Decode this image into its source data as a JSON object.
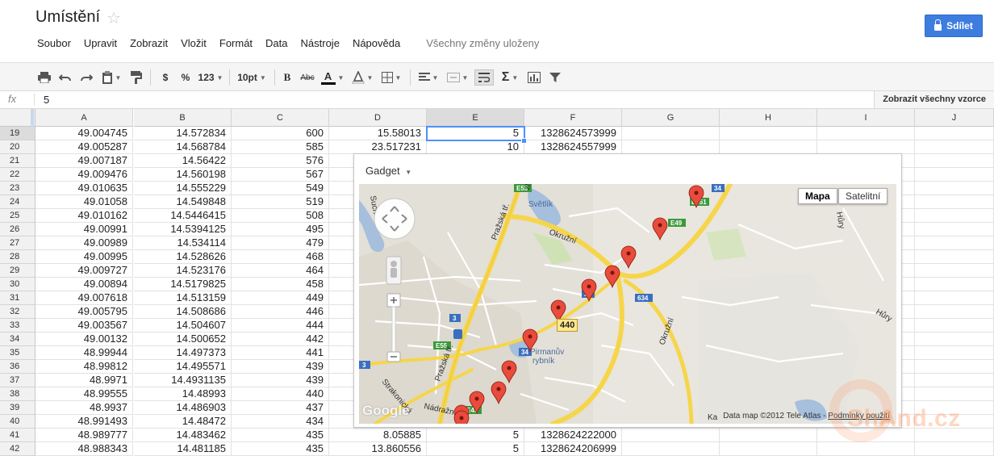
{
  "doc": {
    "title": "Umístění",
    "star_icon": "star-outline-icon"
  },
  "menu": [
    "Soubor",
    "Upravit",
    "Zobrazit",
    "Vložit",
    "Formát",
    "Data",
    "Nástroje",
    "Nápověda"
  ],
  "save_status": "Všechny změny uloženy",
  "share_label": "Sdílet",
  "toolbar": {
    "currency": "$",
    "percent": "%",
    "number_format": "123",
    "font_size": "10pt",
    "bold": "B",
    "strikethrough": "Abc",
    "text_color": "A",
    "text_color_value": "#000000"
  },
  "formula_bar": {
    "fx": "fx",
    "value": "5",
    "show_all": "Zobrazit všechny vzorce"
  },
  "columns": [
    "A",
    "B",
    "C",
    "D",
    "E",
    "F",
    "G",
    "H",
    "I",
    "J"
  ],
  "selected_column": "E",
  "selected_row": "19",
  "rows": [
    {
      "n": "19",
      "a": "49.004745",
      "b": "14.572834",
      "c": "600",
      "d": "15.58013",
      "e": "5",
      "f": "1328624573999"
    },
    {
      "n": "20",
      "a": "49.005287",
      "b": "14.568784",
      "c": "585",
      "d": "23.517231",
      "e": "10",
      "f": "1328624557999"
    },
    {
      "n": "21",
      "a": "49.007187",
      "b": "14.56422",
      "c": "576",
      "d": "",
      "e": "",
      "f": ""
    },
    {
      "n": "22",
      "a": "49.009476",
      "b": "14.560198",
      "c": "567",
      "d": "",
      "e": "",
      "f": ""
    },
    {
      "n": "23",
      "a": "49.010635",
      "b": "14.555229",
      "c": "549",
      "d": "",
      "e": "",
      "f": ""
    },
    {
      "n": "24",
      "a": "49.01058",
      "b": "14.549848",
      "c": "519",
      "d": "",
      "e": "",
      "f": ""
    },
    {
      "n": "25",
      "a": "49.010162",
      "b": "14.5446415",
      "c": "508",
      "d": "",
      "e": "",
      "f": ""
    },
    {
      "n": "26",
      "a": "49.00991",
      "b": "14.5394125",
      "c": "495",
      "d": "",
      "e": "",
      "f": ""
    },
    {
      "n": "27",
      "a": "49.00989",
      "b": "14.534114",
      "c": "479",
      "d": "",
      "e": "",
      "f": ""
    },
    {
      "n": "28",
      "a": "49.00995",
      "b": "14.528626",
      "c": "468",
      "d": "",
      "e": "",
      "f": ""
    },
    {
      "n": "29",
      "a": "49.009727",
      "b": "14.523176",
      "c": "464",
      "d": "",
      "e": "",
      "f": ""
    },
    {
      "n": "30",
      "a": "49.00894",
      "b": "14.5179825",
      "c": "458",
      "d": "",
      "e": "",
      "f": ""
    },
    {
      "n": "31",
      "a": "49.007618",
      "b": "14.513159",
      "c": "449",
      "d": "",
      "e": "",
      "f": ""
    },
    {
      "n": "32",
      "a": "49.005795",
      "b": "14.508686",
      "c": "446",
      "d": "",
      "e": "",
      "f": ""
    },
    {
      "n": "33",
      "a": "49.003567",
      "b": "14.504607",
      "c": "444",
      "d": "",
      "e": "",
      "f": ""
    },
    {
      "n": "34",
      "a": "49.00132",
      "b": "14.500652",
      "c": "442",
      "d": "",
      "e": "",
      "f": ""
    },
    {
      "n": "35",
      "a": "48.99944",
      "b": "14.497373",
      "c": "441",
      "d": "",
      "e": "",
      "f": ""
    },
    {
      "n": "36",
      "a": "48.99812",
      "b": "14.495571",
      "c": "439",
      "d": "",
      "e": "",
      "f": ""
    },
    {
      "n": "37",
      "a": "48.9971",
      "b": "14.4931135",
      "c": "439",
      "d": "",
      "e": "",
      "f": ""
    },
    {
      "n": "38",
      "a": "48.99555",
      "b": "14.48993",
      "c": "440",
      "d": "",
      "e": "",
      "f": ""
    },
    {
      "n": "39",
      "a": "48.9937",
      "b": "14.486903",
      "c": "437",
      "d": "",
      "e": "",
      "f": ""
    },
    {
      "n": "40",
      "a": "48.991493",
      "b": "14.48472",
      "c": "434",
      "d": "",
      "e": "",
      "f": ""
    },
    {
      "n": "41",
      "a": "48.989777",
      "b": "14.483462",
      "c": "435",
      "d": "8.05885",
      "e": "5",
      "f": "1328624222000"
    },
    {
      "n": "42",
      "a": "48.988343",
      "b": "14.481185",
      "c": "435",
      "d": "13.860556",
      "e": "5",
      "f": "1328624206999"
    }
  ],
  "gadget": {
    "title": "Gadget",
    "map_type_map": "Mapa",
    "map_type_satellite": "Satelitní",
    "copyright": "Data map ©2012 Tele Atlas -",
    "terms_link": "Podmínky použití",
    "google_logo": "Google",
    "marker_tooltip": "440",
    "labels": {
      "pivovar": "Pražská tř.",
      "okruzni1": "Okružní",
      "okruzni2": "Okružní",
      "svetlik": "Světlík",
      "rybnik1": "Pirmanův",
      "rybnik2": "rybník",
      "nadrazni": "Nádražní",
      "strakonicka": "Strakonická",
      "prazska2": "Pražská tř.",
      "hury1": "Hůry",
      "hury2": "Hůry",
      "such": "Such",
      "ka": "Ka",
      "zlicky": "zlický",
      "e55a": "E55",
      "e55b": "E55",
      "e49a": "E49",
      "e49b": "E49",
      "r34a": "34",
      "r34b": "34",
      "r34c": "34",
      "r3a": "3",
      "r3b": "3",
      "r634": "634",
      "e551": "E551"
    }
  },
  "watermark": "ShAnd.cz"
}
